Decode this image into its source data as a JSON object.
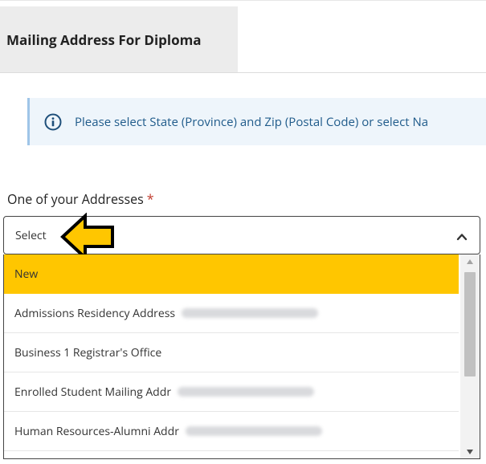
{
  "section": {
    "title": "Mailing Address For Diploma"
  },
  "info_banner": {
    "icon": "info-circle-icon",
    "text": "Please select State (Province) and Zip (Postal Code) or select Na"
  },
  "address_field": {
    "label": "One of your Addresses",
    "required_marker": "*",
    "selected_value": "Select",
    "options": [
      {
        "label": "New",
        "highlighted": true
      },
      {
        "label": "Admissions Residency Address",
        "redacted": true
      },
      {
        "label": "Business 1 Registrar's Office"
      },
      {
        "label": "Enrolled Student Mailing Addr",
        "redacted": true
      },
      {
        "label": "Human Resources-Alumni Addr",
        "redacted": true
      }
    ]
  },
  "colors": {
    "highlight": "#ffc600",
    "info_text": "#1e5a8a",
    "info_background": "#eef5fb",
    "required": "#c0392b",
    "callout_arrow": "#ffc600"
  }
}
